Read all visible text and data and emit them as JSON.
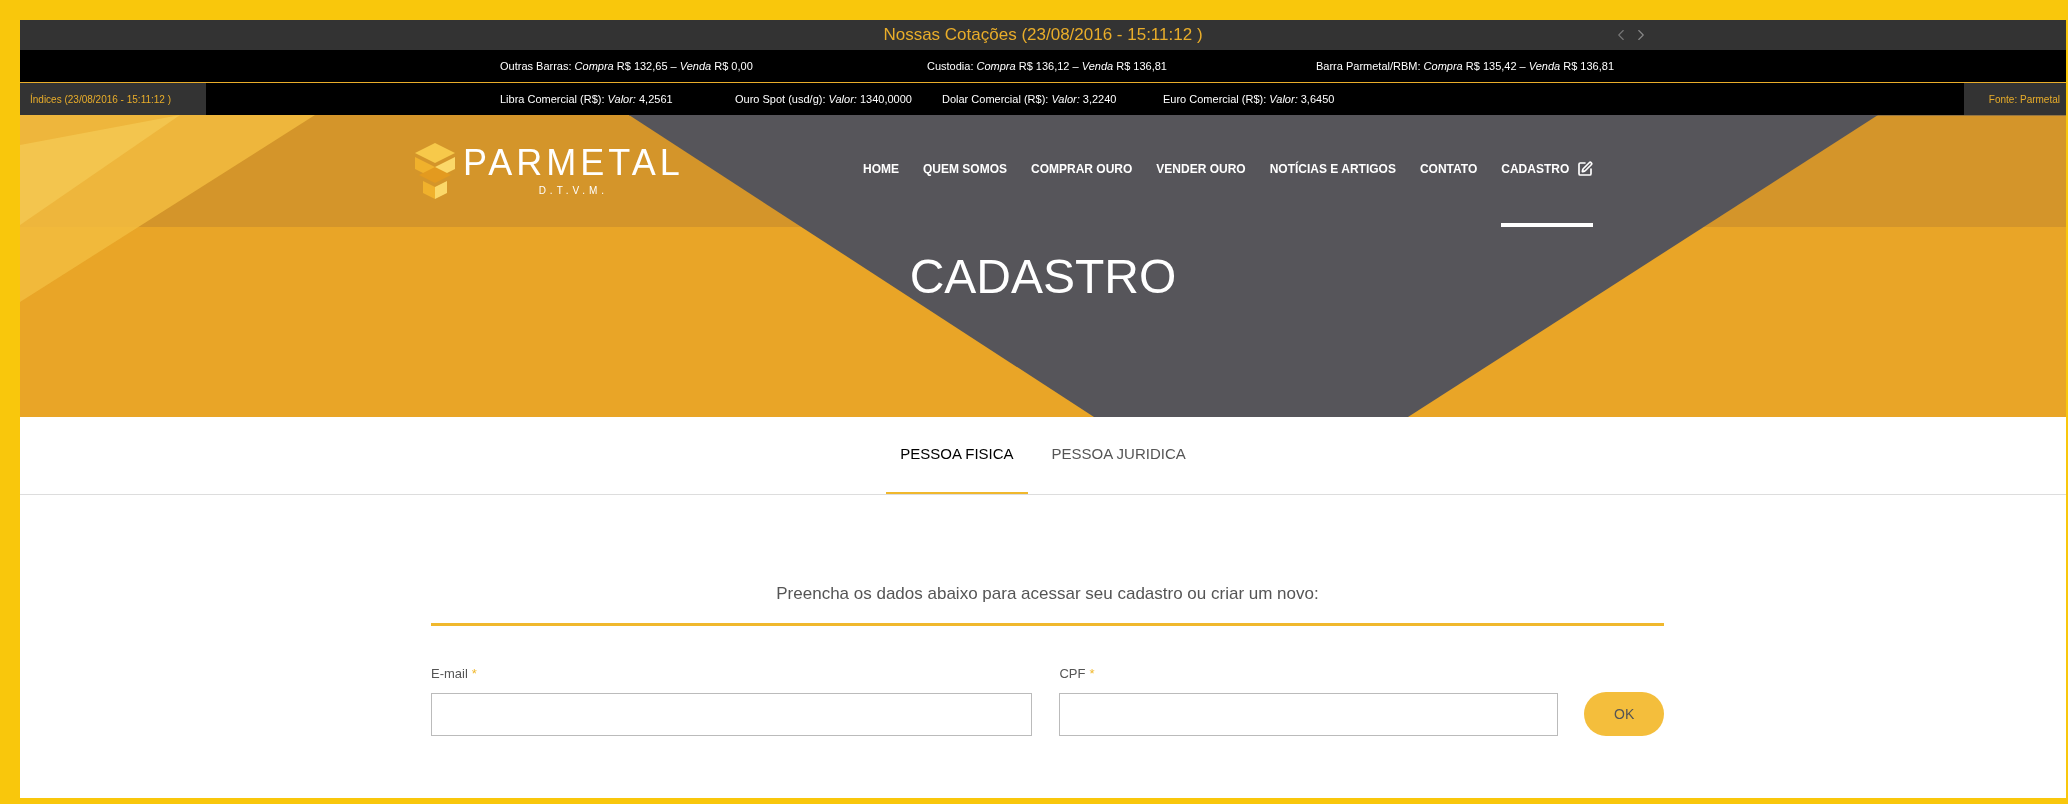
{
  "ticker": {
    "title": "Nossas Cotações (23/08/2016 - 15:11:12 )",
    "quotes": [
      "Outras Barras: *Compra* R$ 132,65 – *Venda* R$ 0,00",
      "Custodia: *Compra* R$ 136,12 – *Venda* R$ 136,81",
      "Barra Parmetal/RBM: *Compra* R$ 135,42 – *Venda* R$ 136,81"
    ],
    "index_label": "Índices (23/08/2016 - 15:11:12 )",
    "indices": [
      "Libra Comercial (R$): *Valor:* 4,2561",
      "Ouro Spot (usd/g): *Valor:* 1340,0000",
      "Dolar Comercial (R$): *Valor:* 3,2240",
      "Euro Comercial (R$): *Valor:* 3,6450"
    ],
    "source": "Fonte: Parmetal"
  },
  "brand": {
    "name": "PARMETAL",
    "tagline": "D.T.V.M."
  },
  "nav": [
    {
      "label": "HOME",
      "selected": false,
      "kind": "link"
    },
    {
      "label": "QUEM SOMOS",
      "selected": false,
      "kind": "link"
    },
    {
      "label": "COMPRAR OURO",
      "selected": false,
      "kind": "link"
    },
    {
      "label": "VENDER OURO",
      "selected": false,
      "kind": "link"
    },
    {
      "label": "NOTÍCIAS E ARTIGOS",
      "selected": false,
      "kind": "link"
    },
    {
      "label": "CONTATO",
      "selected": false,
      "kind": "link"
    },
    {
      "label": "CADASTRO",
      "selected": true,
      "kind": "edit"
    }
  ],
  "page_title": "CADASTRO",
  "tabs": [
    {
      "label": "PESSOA FISICA",
      "selected": true
    },
    {
      "label": "PESSOA JURIDICA",
      "selected": false
    }
  ],
  "form": {
    "intro": "Preencha os dados abaixo para acessar seu cadastro ou criar um novo:",
    "fields": [
      {
        "label": "E-mail",
        "marker": "*"
      },
      {
        "label": "CPF",
        "marker": "*"
      }
    ],
    "submit": "OK"
  }
}
